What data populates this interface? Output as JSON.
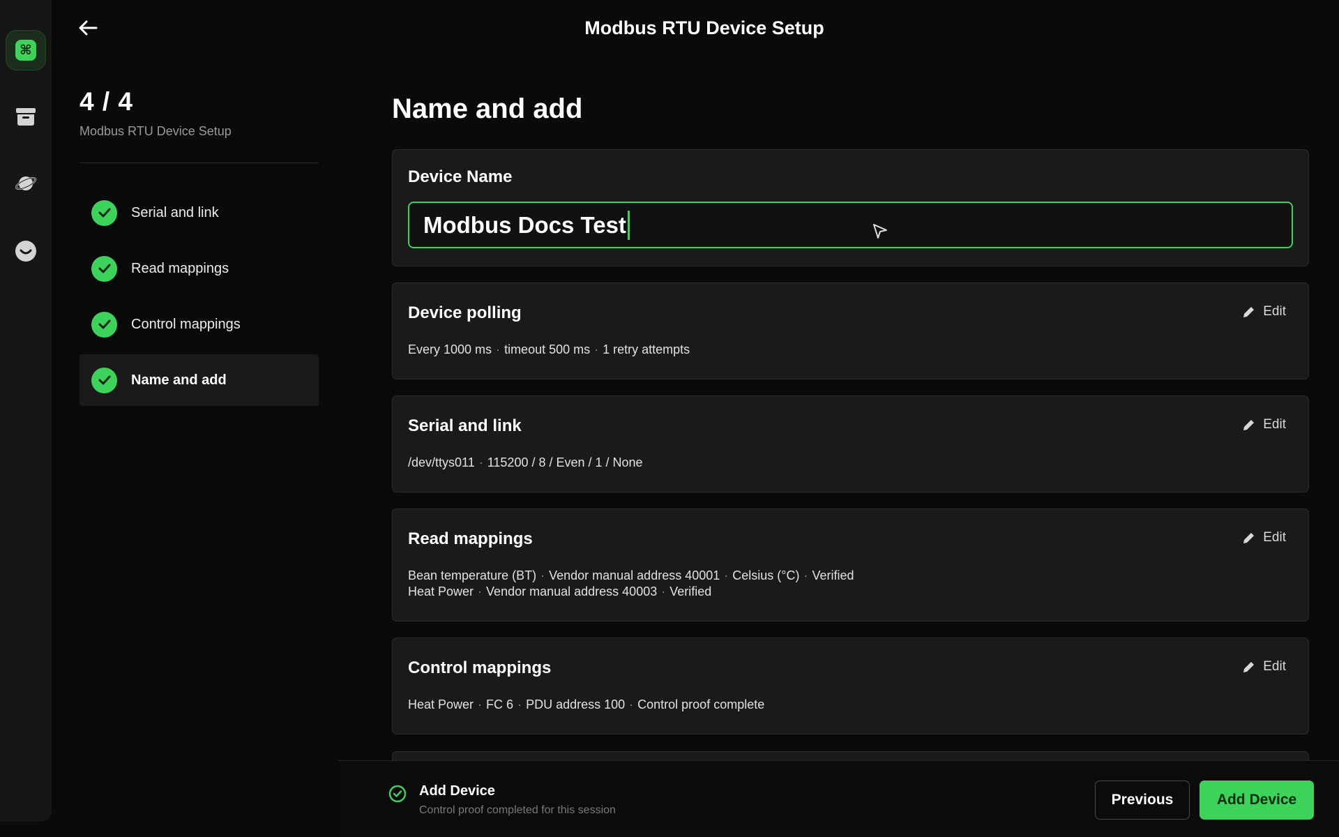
{
  "header": {
    "title": "Modbus RTU Device Setup"
  },
  "rail": {
    "items": [
      {
        "icon": "app-command-icon",
        "glyph": "⌘"
      },
      {
        "icon": "archive-box-icon"
      },
      {
        "icon": "planet-icon"
      },
      {
        "icon": "smiley-face-icon"
      }
    ]
  },
  "steps": {
    "counter": "4 / 4",
    "subtitle": "Modbus RTU Device Setup",
    "items": [
      {
        "label": "Serial and link",
        "status": "complete"
      },
      {
        "label": "Read mappings",
        "status": "complete"
      },
      {
        "label": "Control mappings",
        "status": "complete"
      },
      {
        "label": "Name and add",
        "status": "complete"
      }
    ]
  },
  "main": {
    "title": "Name and add",
    "device_name": {
      "label": "Device Name",
      "value": "Modbus Docs Test"
    },
    "cards": [
      {
        "title": "Device polling",
        "edit_label": "Edit",
        "lines": [
          [
            "Every 1000 ms",
            "timeout 500 ms",
            "1 retry attempts"
          ]
        ]
      },
      {
        "title": "Serial and link",
        "edit_label": "Edit",
        "lines": [
          [
            "/dev/ttys011",
            "115200 / 8 / Even / 1 / None"
          ]
        ]
      },
      {
        "title": "Read mappings",
        "edit_label": "Edit",
        "lines": [
          [
            "Bean temperature (BT)",
            "Vendor manual address 40001",
            "Celsius (°C)",
            "Verified"
          ],
          [
            "Heat Power",
            "Vendor manual address 40003",
            "Verified"
          ]
        ]
      },
      {
        "title": "Control mappings",
        "edit_label": "Edit",
        "lines": [
          [
            "Heat Power",
            "FC 6",
            "PDU address 100",
            "Control proof complete"
          ]
        ]
      }
    ],
    "separator": "·"
  },
  "footer": {
    "status_title": "Add Device",
    "status_sub": "Control proof completed for this session",
    "previous_label": "Previous",
    "add_label": "Add Device"
  },
  "colors": {
    "accent": "#3dd35a",
    "background": "#0a0a0a",
    "card": "#1a1a1a"
  }
}
